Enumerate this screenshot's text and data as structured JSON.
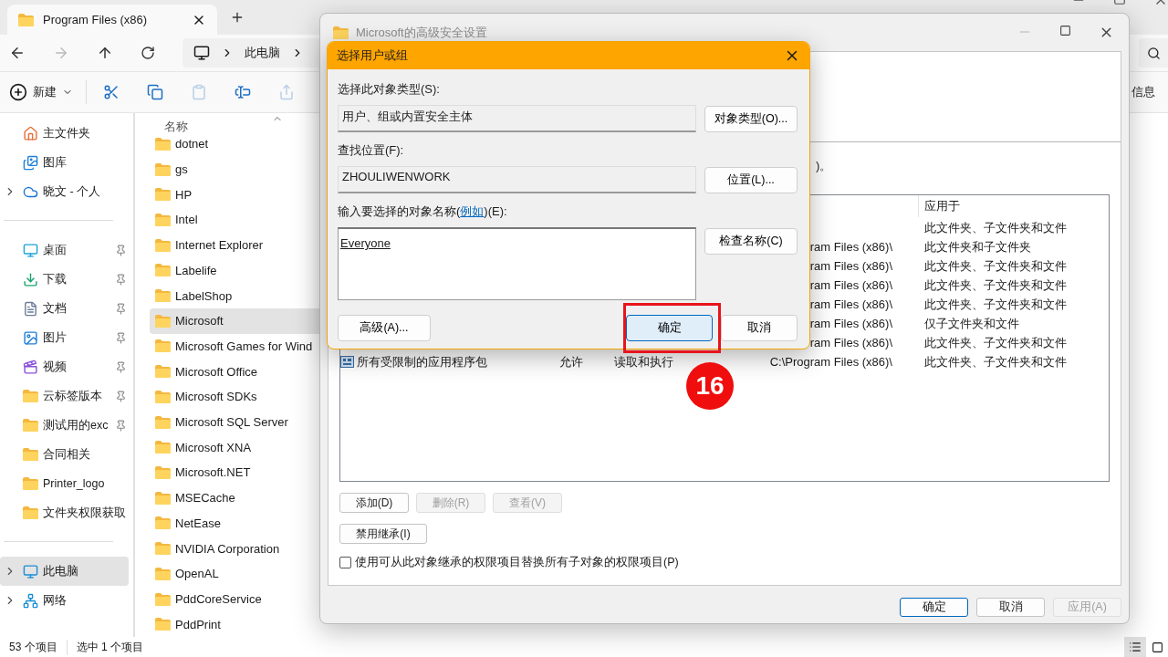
{
  "explorer": {
    "tab_title": "Program Files (x86)",
    "address": [
      "此电脑"
    ],
    "new_button": "新建",
    "details_label": "信息",
    "sidebar": {
      "groups": [
        [
          {
            "label": "主文件夹",
            "expandable": false,
            "pinned": false,
            "selected": false
          },
          {
            "label": "图库",
            "expandable": false,
            "pinned": false,
            "selected": false
          },
          {
            "label": "晓文 - 个人",
            "expandable": true,
            "pinned": false,
            "selected": false
          }
        ],
        [
          {
            "label": "桌面",
            "expandable": false,
            "pinned": true,
            "selected": false
          },
          {
            "label": "下载",
            "expandable": false,
            "pinned": true,
            "selected": false
          },
          {
            "label": "文档",
            "expandable": false,
            "pinned": true,
            "selected": false
          },
          {
            "label": "图片",
            "expandable": false,
            "pinned": true,
            "selected": false
          },
          {
            "label": "视频",
            "expandable": false,
            "pinned": true,
            "selected": false
          },
          {
            "label": "云标签版本",
            "expandable": false,
            "pinned": true,
            "selected": false
          },
          {
            "label": "测试用的exc",
            "expandable": false,
            "pinned": true,
            "selected": false
          },
          {
            "label": "合同相关",
            "expandable": false,
            "pinned": false,
            "selected": false
          },
          {
            "label": "Printer_logo",
            "expandable": false,
            "pinned": false,
            "selected": false
          },
          {
            "label": "文件夹权限获取",
            "expandable": false,
            "pinned": false,
            "selected": false
          }
        ],
        [
          {
            "label": "此电脑",
            "expandable": true,
            "pinned": false,
            "selected": true
          },
          {
            "label": "网络",
            "expandable": true,
            "pinned": false,
            "selected": false
          }
        ]
      ]
    },
    "file_list": {
      "name_header": "名称",
      "rows": [
        {
          "name": "dotnet",
          "selected": false
        },
        {
          "name": "gs",
          "selected": false
        },
        {
          "name": "HP",
          "selected": false
        },
        {
          "name": "Intel",
          "selected": false
        },
        {
          "name": "Internet Explorer",
          "selected": false
        },
        {
          "name": "Labelife",
          "selected": false
        },
        {
          "name": "LabelShop",
          "selected": false
        },
        {
          "name": "Microsoft",
          "selected": true
        },
        {
          "name": "Microsoft Games for Wind",
          "selected": false
        },
        {
          "name": "Microsoft Office",
          "selected": false
        },
        {
          "name": "Microsoft SDKs",
          "selected": false
        },
        {
          "name": "Microsoft SQL Server",
          "selected": false
        },
        {
          "name": "Microsoft XNA",
          "selected": false
        },
        {
          "name": "Microsoft.NET",
          "selected": false
        },
        {
          "name": "MSECache",
          "selected": false
        },
        {
          "name": "NetEase",
          "selected": false
        },
        {
          "name": "NVIDIA Corporation",
          "selected": false
        },
        {
          "name": "OpenAL",
          "selected": false
        },
        {
          "name": "PddCoreService",
          "selected": false
        },
        {
          "name": "PddPrint",
          "selected": false
        }
      ]
    },
    "status": [
      "53 个项目",
      "选中 1 个项目"
    ]
  },
  "security_dialog": {
    "title": "Microsoft的高级安全设置",
    "note": ")。",
    "table": {
      "applies_header": "应用于",
      "rows": [
        {
          "applies_to": "此文件夹、子文件夹和文件"
        },
        {
          "inherited": "ram Files (x86)\\",
          "applies_to": "此文件夹和子文件夹"
        },
        {
          "inherited": "ram Files (x86)\\",
          "applies_to": "此文件夹、子文件夹和文件"
        },
        {
          "inherited": "ram Files (x86)\\",
          "applies_to": "此文件夹、子文件夹和文件"
        },
        {
          "inherited": "ram Files (x86)\\",
          "applies_to": "此文件夹、子文件夹和文件"
        },
        {
          "inherited": "ram Files (x86)\\",
          "applies_to": "仅子文件夹和文件"
        },
        {
          "inherited": "ram Files (x86)\\",
          "applies_to": "此文件夹、子文件夹和文件"
        },
        {
          "name": "所有受限制的应用程序包",
          "type": "允许",
          "access": "读取和执行",
          "inherited": "C:\\Program Files (x86)\\",
          "applies_to": "此文件夹、子文件夹和文件"
        }
      ]
    },
    "buttons": [
      {
        "label": "添加(D)",
        "disabled": false
      },
      {
        "label": "删除(R)",
        "disabled": true
      },
      {
        "label": "查看(V)",
        "disabled": true
      }
    ],
    "inherit_button": "禁用继承(I)",
    "replace_checkbox": {
      "label": "使用可从此对象继承的权限项目替换所有子对象的权限项目(P)",
      "checked": false
    },
    "footer_buttons": [
      {
        "label": "确定",
        "default": true,
        "disabled": false
      },
      {
        "label": "取消",
        "default": false,
        "disabled": false
      },
      {
        "label": "应用(A)",
        "default": false,
        "disabled": true
      }
    ]
  },
  "select_dialog": {
    "title": "选择用户或组",
    "object_type": {
      "label": "选择此对象类型(S):",
      "value": "用户、组或内置安全主体",
      "button": "对象类型(O)..."
    },
    "location": {
      "label": "查找位置(F):",
      "value": "ZHOULIWENWORK",
      "button": "位置(L)..."
    },
    "names": {
      "label_before": "输入要选择的对象名称(",
      "link": "例如",
      "label_after": ")(E):",
      "value": "Everyone",
      "button": "检查名称(C)"
    },
    "advanced_button": "高级(A)...",
    "buttons": [
      {
        "label": "确定",
        "default": true
      },
      {
        "label": "取消",
        "default": false
      }
    ]
  },
  "annotation": {
    "step": "16"
  }
}
